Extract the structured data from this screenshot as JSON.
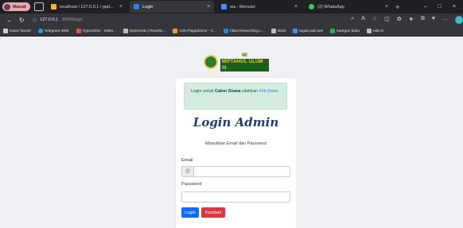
{
  "browser": {
    "profile_label": "Masuk",
    "tabs": [
      {
        "title": "localhost / 127.0.0.1 / ppdb | php",
        "fav_color": "#f0b14a",
        "active": false
      },
      {
        "title": "Login",
        "fav_color": "#3a7bd5",
        "active": true
      },
      {
        "title": "wa - Mencari",
        "fav_color": "#4c8bf5",
        "active": false
      },
      {
        "title": "(2) WhatsApp",
        "fav_color": "#25d366",
        "active": false
      }
    ],
    "address": {
      "host": "127.0.0.1",
      "path": ":8000/login"
    },
    "bookmarks": [
      {
        "label": "Impor favorit",
        "color": "#cccccc"
      },
      {
        "label": "Telegram Web",
        "color": "#2aa3e0"
      },
      {
        "label": "Typoonline - KBBI...",
        "color": "#d9534f"
      },
      {
        "label": "SpinnerID | Rewrite...",
        "color": "#bbbbbb"
      },
      {
        "label": "Cek Plagiarisme - C...",
        "color": "#f0a030"
      },
      {
        "label": "https://www.bing.c...",
        "color": "#1e88e5"
      },
      {
        "label": "dsd3",
        "color": "#bbbbbb"
      },
      {
        "label": "tugas pak aan",
        "color": "#4c8bf5"
      },
      {
        "label": "kategori buku",
        "color": "#34a853"
      },
      {
        "label": "edit AI",
        "color": "#bbbbbb"
      }
    ]
  },
  "logo": {
    "line1": "MI",
    "line2": "MIFTAHUL ULUM III"
  },
  "login": {
    "alert": {
      "prefix": "Login untuk",
      "bold": "Calon Siswa",
      "middle": "silahkan",
      "link": "Klik Disini"
    },
    "title": "Login Admin",
    "subtitle": "Masukkan Email dan Password",
    "email_label": "Email",
    "email_icon": "@",
    "password_label": "Password",
    "login_button": "Login",
    "back_button": "Kembali"
  }
}
